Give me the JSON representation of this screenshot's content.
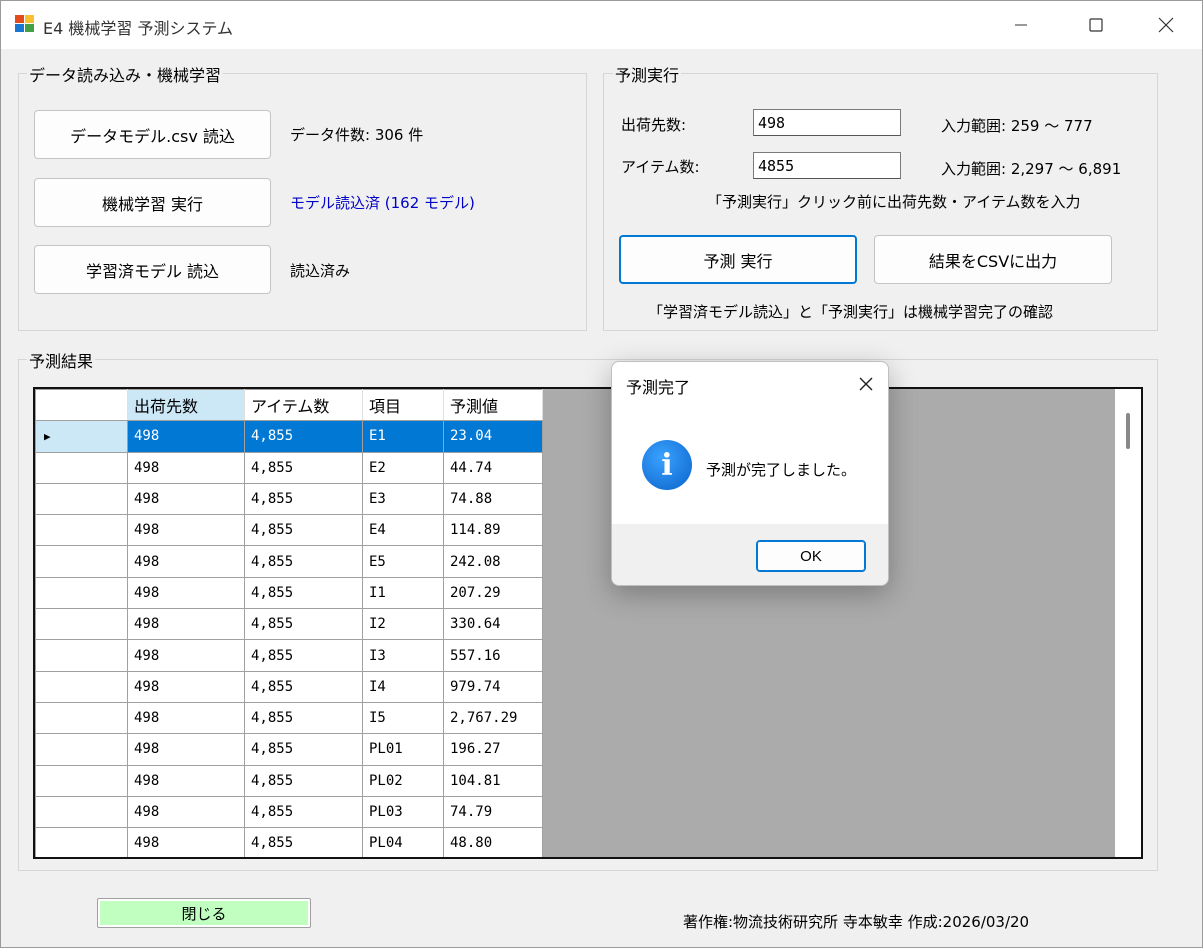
{
  "window": {
    "title": "E4 機械学習 予測システム"
  },
  "data_group": {
    "title": "データ読み込み・機械学習",
    "load_csv_label": "データモデル.csv 読込",
    "data_count_text": "データ件数: 306 件",
    "train_label": "機械学習 実行",
    "model_status_text": "モデル読込済 (162 モデル)",
    "load_model_label": "学習済モデル 読込",
    "load_model_status": "読込済み"
  },
  "predict_group": {
    "title": "予測実行",
    "ship_label": "出荷先数:",
    "ship_value": "498",
    "ship_range": "入力範囲: 259 ～ 777",
    "item_label": "アイテム数:",
    "item_value": "4855",
    "item_range": "入力範囲: 2,297 ～ 6,891",
    "hint_text": "「予測実行」クリック前に出荷先数・アイテム数を入力",
    "run_label": "予測 実行",
    "export_label": "結果をCSVに出力",
    "note_text": "「学習済モデル読込」と「予測実行」は機械学習完了の確認"
  },
  "results_group": {
    "title": "予測結果",
    "columns": [
      "出荷先数",
      "アイテム数",
      "項目",
      "予測値"
    ],
    "rows": [
      [
        "498",
        "4,855",
        "E1",
        "23.04"
      ],
      [
        "498",
        "4,855",
        "E2",
        "44.74"
      ],
      [
        "498",
        "4,855",
        "E3",
        "74.88"
      ],
      [
        "498",
        "4,855",
        "E4",
        "114.89"
      ],
      [
        "498",
        "4,855",
        "E5",
        "242.08"
      ],
      [
        "498",
        "4,855",
        "I1",
        "207.29"
      ],
      [
        "498",
        "4,855",
        "I2",
        "330.64"
      ],
      [
        "498",
        "4,855",
        "I3",
        "557.16"
      ],
      [
        "498",
        "4,855",
        "I4",
        "979.74"
      ],
      [
        "498",
        "4,855",
        "I5",
        "2,767.29"
      ],
      [
        "498",
        "4,855",
        "PL01",
        "196.27"
      ],
      [
        "498",
        "4,855",
        "PL02",
        "104.81"
      ],
      [
        "498",
        "4,855",
        "PL03",
        "74.79"
      ],
      [
        "498",
        "4,855",
        "PL04",
        "48.80"
      ]
    ]
  },
  "footer": {
    "close_label": "閉じる",
    "copyright": "著作権:物流技術研究所 寺本敏幸 作成:2026/03/20"
  },
  "dialog": {
    "title": "予測完了",
    "message": "予測が完了しました。",
    "ok_label": "OK",
    "icon": "info-icon"
  },
  "colors": {
    "accent": "#0078d4",
    "selected_header": "#cce8f7",
    "close_button_fill": "#c0ffc0",
    "status_blue": "#0000c8"
  }
}
